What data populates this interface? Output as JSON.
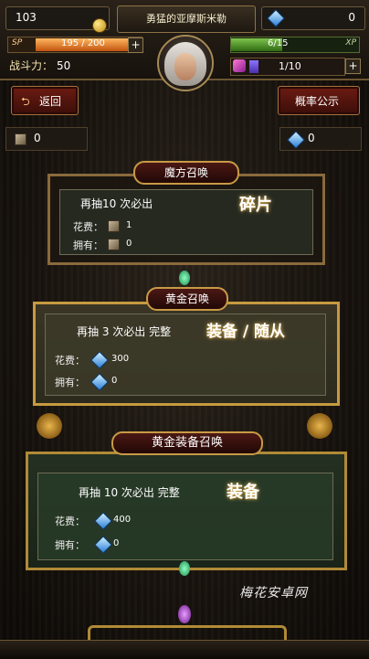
{
  "header": {
    "gold": "103",
    "player_name": "勇猛的亚摩斯米勒",
    "gems": "0",
    "sp_tag": "SP",
    "sp_value": "195 / 200",
    "sp_fraction": 0.975,
    "power_label": "战斗力：",
    "power_value": "50",
    "xp_value": "6/15",
    "xp_tag": "XP",
    "xp_fraction": 0.4,
    "potion_value": "1/10",
    "potion_fraction": 0.1,
    "plus": "+"
  },
  "nav": {
    "back_label": "返回",
    "back_glyph": "⮌",
    "rates_label": "概率公示"
  },
  "counters": {
    "cube_count": "0",
    "gem_count": "0"
  },
  "cards": [
    {
      "title": "魔方召唤",
      "line": "再抽10 次必出",
      "big": "碎片",
      "cost_label": "花费：",
      "cost_value": "1",
      "own_label": "拥有：",
      "own_value": "0",
      "currency_icon": "cube-icon"
    },
    {
      "title": "黄金召唤",
      "line": "再抽 3 次必出 完整",
      "big": "装备 / 随从",
      "cost_label": "花费：",
      "cost_value": "300",
      "own_label": "拥有：",
      "own_value": "0",
      "currency_icon": "gem-icon"
    },
    {
      "title": "黄金装备召唤",
      "line": "再抽 10 次必出 完整",
      "big": "装备",
      "cost_label": "花费：",
      "cost_value": "400",
      "own_label": "拥有：",
      "own_value": "0",
      "currency_icon": "gem-icon"
    }
  ],
  "watermark": "梅花安卓网",
  "colors": {
    "bronze_border": "#8a6a3c",
    "gold_border": "#c79a3f",
    "ornate_border": "#b08a36",
    "green_gem": "#2ccf7a",
    "purple_gem": "#b03ad8"
  }
}
